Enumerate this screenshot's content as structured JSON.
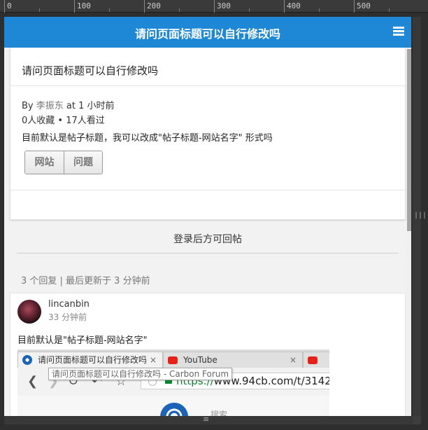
{
  "ruler": {
    "labels": [
      "0",
      "100",
      "200",
      "300",
      "400",
      "500"
    ]
  },
  "header": {
    "title": "请问页面标题可以自行修改吗",
    "menu_icon": "hamburger-menu-icon",
    "color": "#1e87d6"
  },
  "topic": {
    "title": "请问页面标题可以自行修改吗",
    "by_label": "By",
    "author": "李振东",
    "time": "at 1 小时前",
    "stats": "0人收藏 • 17人看过",
    "body": "目前默认是帖子标题，我可以改成\"帖子标题-网站名字\" 形式吗",
    "tags": [
      "网站",
      "问题"
    ]
  },
  "login_note": "登录后方可回帖",
  "replies": {
    "summary": "3 个回复 | 最后更新于 3 分钟前",
    "items": [
      {
        "user": "lincanbin",
        "time": "33 分钟前",
        "text": "目前默认是\"帖子标题-网站名字\"",
        "screenshot": {
          "tab1": "请问页面标题可以自行修改吗",
          "tab2": "YouTube",
          "tooltip": "请问页面标题可以自行修改吗 - Carbon Forum",
          "url_scheme": "https://",
          "url_rest": "www.94cb.com/t/3142",
          "search_label": "搜索"
        }
      }
    ]
  }
}
